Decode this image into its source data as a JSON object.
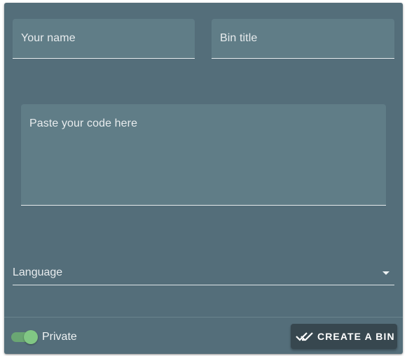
{
  "form": {
    "name_placeholder": "Your name",
    "title_placeholder": "Bin title",
    "code_placeholder": "Paste your code here",
    "language_label": "Language",
    "private_label": "Private",
    "private_on": true,
    "create_button_label": "CREATE A BIN"
  },
  "icons": {
    "dropdown": "caret-down-icon",
    "create": "done-all-icon"
  },
  "colors": {
    "card": "#546e7a",
    "field": "#607d87",
    "button": "#37474f",
    "switch_accent": "#81c784"
  }
}
